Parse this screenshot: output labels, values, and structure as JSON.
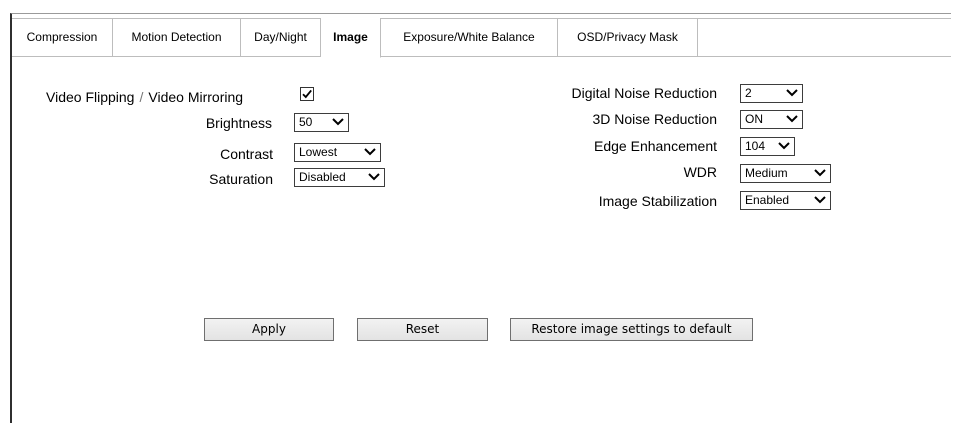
{
  "tabs": [
    {
      "label": "Compression"
    },
    {
      "label": "Motion Detection"
    },
    {
      "label": "Day/Night"
    },
    {
      "label": "Image"
    },
    {
      "label": "Exposure/White Balance"
    },
    {
      "label": "OSD/Privacy Mask"
    }
  ],
  "active_tab": "Image",
  "left": {
    "flip_label": "Video Flipping",
    "separator": "/",
    "mirror_label": "Video Mirroring",
    "flip_mirror_checked": true,
    "brightness_label": "Brightness",
    "brightness_value": "50",
    "contrast_label": "Contrast",
    "contrast_value": "Lowest",
    "saturation_label": "Saturation",
    "saturation_value": "Disabled"
  },
  "right": {
    "dnr_label": "Digital Noise Reduction",
    "dnr_value": "2",
    "nr3d_label": "3D Noise Reduction",
    "nr3d_value": "ON",
    "edge_label": "Edge Enhancement",
    "edge_value": "104",
    "wdr_label": "WDR",
    "wdr_value": "Medium",
    "stab_label": "Image Stabilization",
    "stab_value": "Enabled"
  },
  "buttons": {
    "apply": "Apply",
    "reset": "Reset",
    "restore": "Restore image settings to default"
  },
  "icons": {
    "checkbox": "check-icon",
    "dropdown": "chevron-down-icon"
  }
}
